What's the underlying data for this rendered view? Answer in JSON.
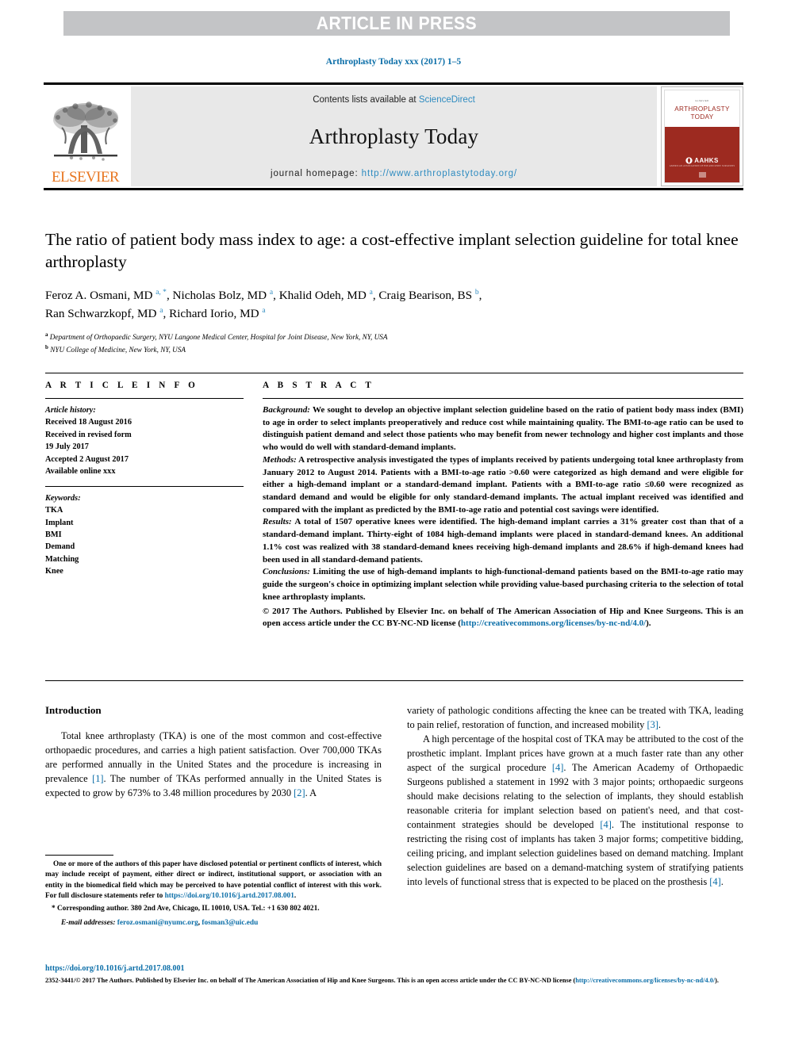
{
  "banner": {
    "text": "ARTICLE IN PRESS"
  },
  "journal_ref": "Arthroplasty Today xxx (2017) 1–5",
  "masthead": {
    "contents_prefix": "Contents lists available at ",
    "contents_link": "ScienceDirect",
    "journal_name": "Arthroplasty Today",
    "homepage_prefix": "journal homepage: ",
    "homepage_url": "http://www.arthroplastytoday.org/",
    "publisher_logo_text": "ELSEVIER",
    "cover": {
      "tiny_top": "ELSEVIER",
      "title_line1": "ARTHROPLASTY",
      "title_line2": "TODAY",
      "society": "AAHKS",
      "society_sub": "AMERICAN ASSOCIATION OF HIP AND KNEE SURGEONS"
    }
  },
  "article": {
    "title": "The ratio of patient body mass index to age: a cost-effective implant selection guideline for total knee arthroplasty",
    "authors": "Feroz A. Osmani, MD a, *, Nicholas Bolz, MD a, Khalid Odeh, MD a, Craig Bearison, BS b, Ran Schwarzkopf, MD a, Richard Iorio, MD a",
    "affiliation_a": "Department of Orthopaedic Surgery, NYU Langone Medical Center, Hospital for Joint Disease, New York, NY, USA",
    "affiliation_b": "NYU College of Medicine, New York, NY, USA"
  },
  "article_info": {
    "heading": "A R T I C L E   I N F O",
    "history_label": "Article history:",
    "history": [
      "Received 18 August 2016",
      "Received in revised form",
      "19 July 2017",
      "Accepted 2 August 2017",
      "Available online xxx"
    ],
    "keywords_label": "Keywords:",
    "keywords": [
      "TKA",
      "Implant",
      "BMI",
      "Demand",
      "Matching",
      "Knee"
    ]
  },
  "abstract": {
    "heading": "A B S T R A C T",
    "sections": [
      {
        "label": "Background:",
        "text": " We sought to develop an objective implant selection guideline based on the ratio of patient body mass index (BMI) to age in order to select implants preoperatively and reduce cost while maintaining quality. The BMI-to-age ratio can be used to distinguish patient demand and select those patients who may benefit from newer technology and higher cost implants and those who would do well with standard-demand implants."
      },
      {
        "label": "Methods:",
        "text": " A retrospective analysis investigated the types of implants received by patients undergoing total knee arthroplasty from January 2012 to August 2014. Patients with a BMI-to-age ratio >0.60 were categorized as high demand and were eligible for either a high-demand implant or a standard-demand implant. Patients with a BMI-to-age ratio ≤0.60 were recognized as standard demand and would be eligible for only standard-demand implants. The actual implant received was identified and compared with the implant as predicted by the BMI-to-age ratio and potential cost savings were identified."
      },
      {
        "label": "Results:",
        "text": " A total of 1507 operative knees were identified. The high-demand implant carries a 31% greater cost than that of a standard-demand implant. Thirty-eight of 1084 high-demand implants were placed in standard-demand knees. An additional 1.1% cost was realized with 38 standard-demand knees receiving high-demand implants and 28.6% if high-demand knees had been used in all standard-demand patients."
      },
      {
        "label": "Conclusions:",
        "text": " Limiting the use of high-demand implants to high-functional-demand patients based on the BMI-to-age ratio may guide the surgeon's choice in optimizing implant selection while providing value-based purchasing criteria to the selection of total knee arthroplasty implants."
      }
    ],
    "copyright_text": "© 2017 The Authors. Published by Elsevier Inc. on behalf of The American Association of Hip and Knee Surgeons. This is an open access article under the CC BY-NC-ND license (",
    "copyright_link": "http://creativecommons.org/licenses/by-nc-nd/4.0/",
    "copyright_tail": ")."
  },
  "body": {
    "intro_heading": "Introduction",
    "left_p1_a": "Total knee arthroplasty (TKA) is one of the most common and cost-effective orthopaedic procedures, and carries a high patient satisfaction. Over 700,000 TKAs are performed annually in the United States and the procedure is increasing in prevalence ",
    "left_ref1": "[1]",
    "left_p1_b": ". The number of TKAs performed annually in the United States is expected to grow by 673% to 3.48 million procedures by 2030 ",
    "left_ref2": "[2]",
    "left_p1_c": ". A",
    "right_p1_a": "variety of pathologic conditions affecting the knee can be treated with TKA, leading to pain relief, restoration of function, and increased mobility ",
    "right_ref3": "[3]",
    "right_p1_b": ".",
    "right_p2_a": "A high percentage of the hospital cost of TKA may be attributed to the cost of the prosthetic implant. Implant prices have grown at a much faster rate than any other aspect of the surgical procedure ",
    "right_ref4a": "[4]",
    "right_p2_b": ". The American Academy of Orthopaedic Surgeons published a statement in 1992 with 3 major points; orthopaedic surgeons should make decisions relating to the selection of implants, they should establish reasonable criteria for implant selection based on patient's need, and that cost-containment strategies should be developed ",
    "right_ref4b": "[4]",
    "right_p2_c": ". The institutional response to restricting the rising cost of implants has taken 3 major forms; competitive bidding, ceiling pricing, and implant selection guidelines based on demand matching. Implant selection guidelines are based on a demand-matching system of stratifying patients into levels of functional stress that is expected to be placed on the prosthesis ",
    "right_ref4c": "[4]",
    "right_p2_d": "."
  },
  "footnotes": {
    "disclosure_a": "One or more of the authors of this paper have disclosed potential or pertinent conflicts of interest, which may include receipt of payment, either direct or indirect, institutional support, or association with an entity in the biomedical field which may be perceived to have potential conflict of interest with this work. For full disclosure statements refer to ",
    "disclosure_link": "https://doi.org/10.1016/j.artd.2017.08.001",
    "disclosure_tail": ".",
    "corresponding": "* Corresponding author. 380 2nd Ave, Chicago, IL 10010, USA. Tel.: +1 630 802 4021.",
    "email_label": "E-mail addresses:",
    "email_1": "feroz.osmani@nyumc.org",
    "email_sep": ", ",
    "email_2": "fosman3@uic.edu"
  },
  "footer": {
    "doi": "https://doi.org/10.1016/j.artd.2017.08.001",
    "issn_text": "2352-3441/© 2017 The Authors. Published by Elsevier Inc. on behalf of The American Association of Hip and Knee Surgeons. This is an open access article under the CC BY-NC-ND license (",
    "issn_link": "http://creativecommons.org/licenses/by-nc-nd/4.0/",
    "issn_tail": ")."
  },
  "colors": {
    "link_blue": "#0b6ea8",
    "sd_blue": "#2e8bc0",
    "elsevier_orange": "#E87722",
    "cover_red": "#9d2a20",
    "banner_gray": "#c3c4c6"
  }
}
